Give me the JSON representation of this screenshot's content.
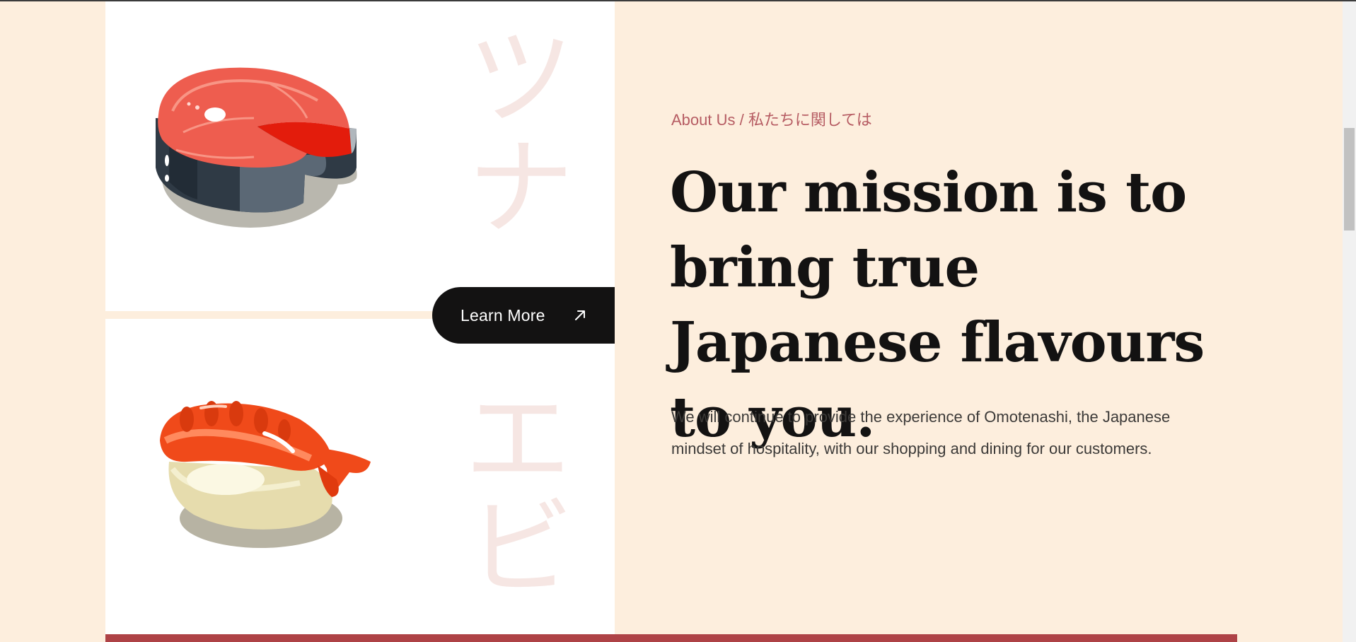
{
  "about": {
    "eyebrow": "About Us / 私たちに関しては",
    "headline": "Our mission is to bring true Japanese flavours to you.",
    "body": "We will continue to provide the experience of Omotenashi, the Japanese mindset of hospitality, with our shopping and dining for our customers."
  },
  "cta": {
    "label": "Learn More",
    "icon": "arrow-up-right-icon"
  },
  "cards": [
    {
      "kana_1": "ツ",
      "kana_2": "ナ",
      "illustration": "tuna-steak-illustration"
    },
    {
      "kana_1": "エ",
      "kana_2": "ビ",
      "illustration": "shrimp-nigiri-illustration"
    }
  ],
  "colors": {
    "page_background": "#fdeedd",
    "accent": "#b65c63",
    "button": "#131212",
    "bottom_bar": "#ae4246",
    "kana": "#f6e6e3"
  }
}
